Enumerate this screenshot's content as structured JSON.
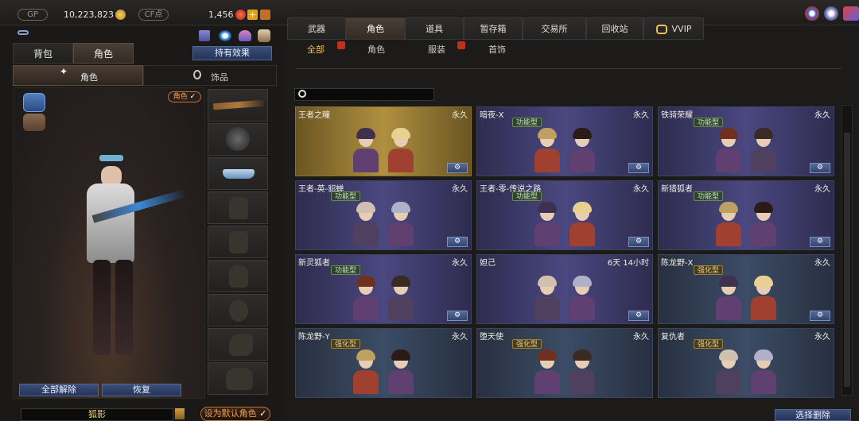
{
  "topbar": {
    "gp_label": "GP",
    "gp_value": "10,223,823",
    "cf_label": "CF点",
    "cf_value": "1,456"
  },
  "left": {
    "tab_bag": "背包",
    "tab_role": "角色",
    "holding_effect": "持有效果",
    "subtab_role": "角色",
    "subtab_accessory": "饰品",
    "role_dropdown": "角色",
    "unequip_all": "全部解除",
    "restore": "恢复",
    "character_name": "狐影",
    "set_default": "设为默认角色"
  },
  "right": {
    "tabs": [
      "武器",
      "角色",
      "道具",
      "暂存箱",
      "交易所",
      "回收站",
      "VVIP"
    ],
    "subtabs": [
      "全部",
      "角色",
      "服装",
      "首饰"
    ],
    "select_delete": "选择删除",
    "cards": [
      {
        "name": "王者之瞳",
        "duration": "永久",
        "badge": "",
        "theme": "gold"
      },
      {
        "name": "暗夜-X",
        "duration": "永久",
        "badge": "功能型",
        "theme": "purple"
      },
      {
        "name": "铁骑荣耀",
        "duration": "永久",
        "badge": "功能型",
        "theme": "purple"
      },
      {
        "name": "王者-英-貂蝉",
        "duration": "永久",
        "badge": "功能型",
        "theme": "purple"
      },
      {
        "name": "王者-零-传说之路",
        "duration": "永久",
        "badge": "功能型",
        "theme": "purple"
      },
      {
        "name": "新猎狐者",
        "duration": "永久",
        "badge": "功能型",
        "theme": "purple"
      },
      {
        "name": "新灵狐者",
        "duration": "永久",
        "badge": "功能型",
        "theme": "purple"
      },
      {
        "name": "妲己",
        "duration": "6天 14小时",
        "badge": "",
        "theme": "purple"
      },
      {
        "name": "陈龙野-X",
        "duration": "永久",
        "badge": "强化型",
        "theme": "blue"
      },
      {
        "name": "陈龙野-Y",
        "duration": "永久",
        "badge": "强化型",
        "theme": "blue"
      },
      {
        "name": "堕天使",
        "duration": "永久",
        "badge": "强化型",
        "theme": "blue"
      },
      {
        "name": "复仇者",
        "duration": "永久",
        "badge": "强化型",
        "theme": "blue"
      }
    ]
  },
  "colors": {
    "accent_gold": "#f0c050",
    "button_blue": "#34466e",
    "card_purple": "#4a4880",
    "card_blue": "#3c4c66"
  }
}
